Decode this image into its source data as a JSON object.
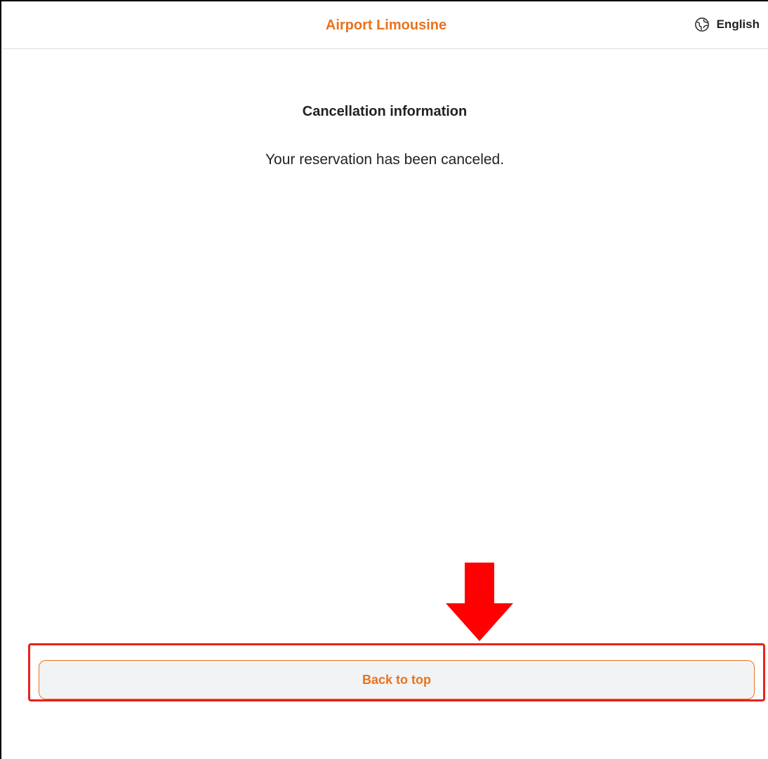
{
  "header": {
    "brand": "Airport Limousine",
    "language": {
      "label": "English",
      "icon": "globe-icon"
    }
  },
  "main": {
    "title": "Cancellation information",
    "message": "Your reservation has been canceled."
  },
  "footer": {
    "back_button_label": "Back to top"
  },
  "annotations": {
    "arrow_icon": "down-arrow-icon",
    "highlight_color": "#e8211c"
  },
  "colors": {
    "accent": "#e8731c",
    "text": "#222222",
    "button_bg": "#f2f3f4"
  }
}
